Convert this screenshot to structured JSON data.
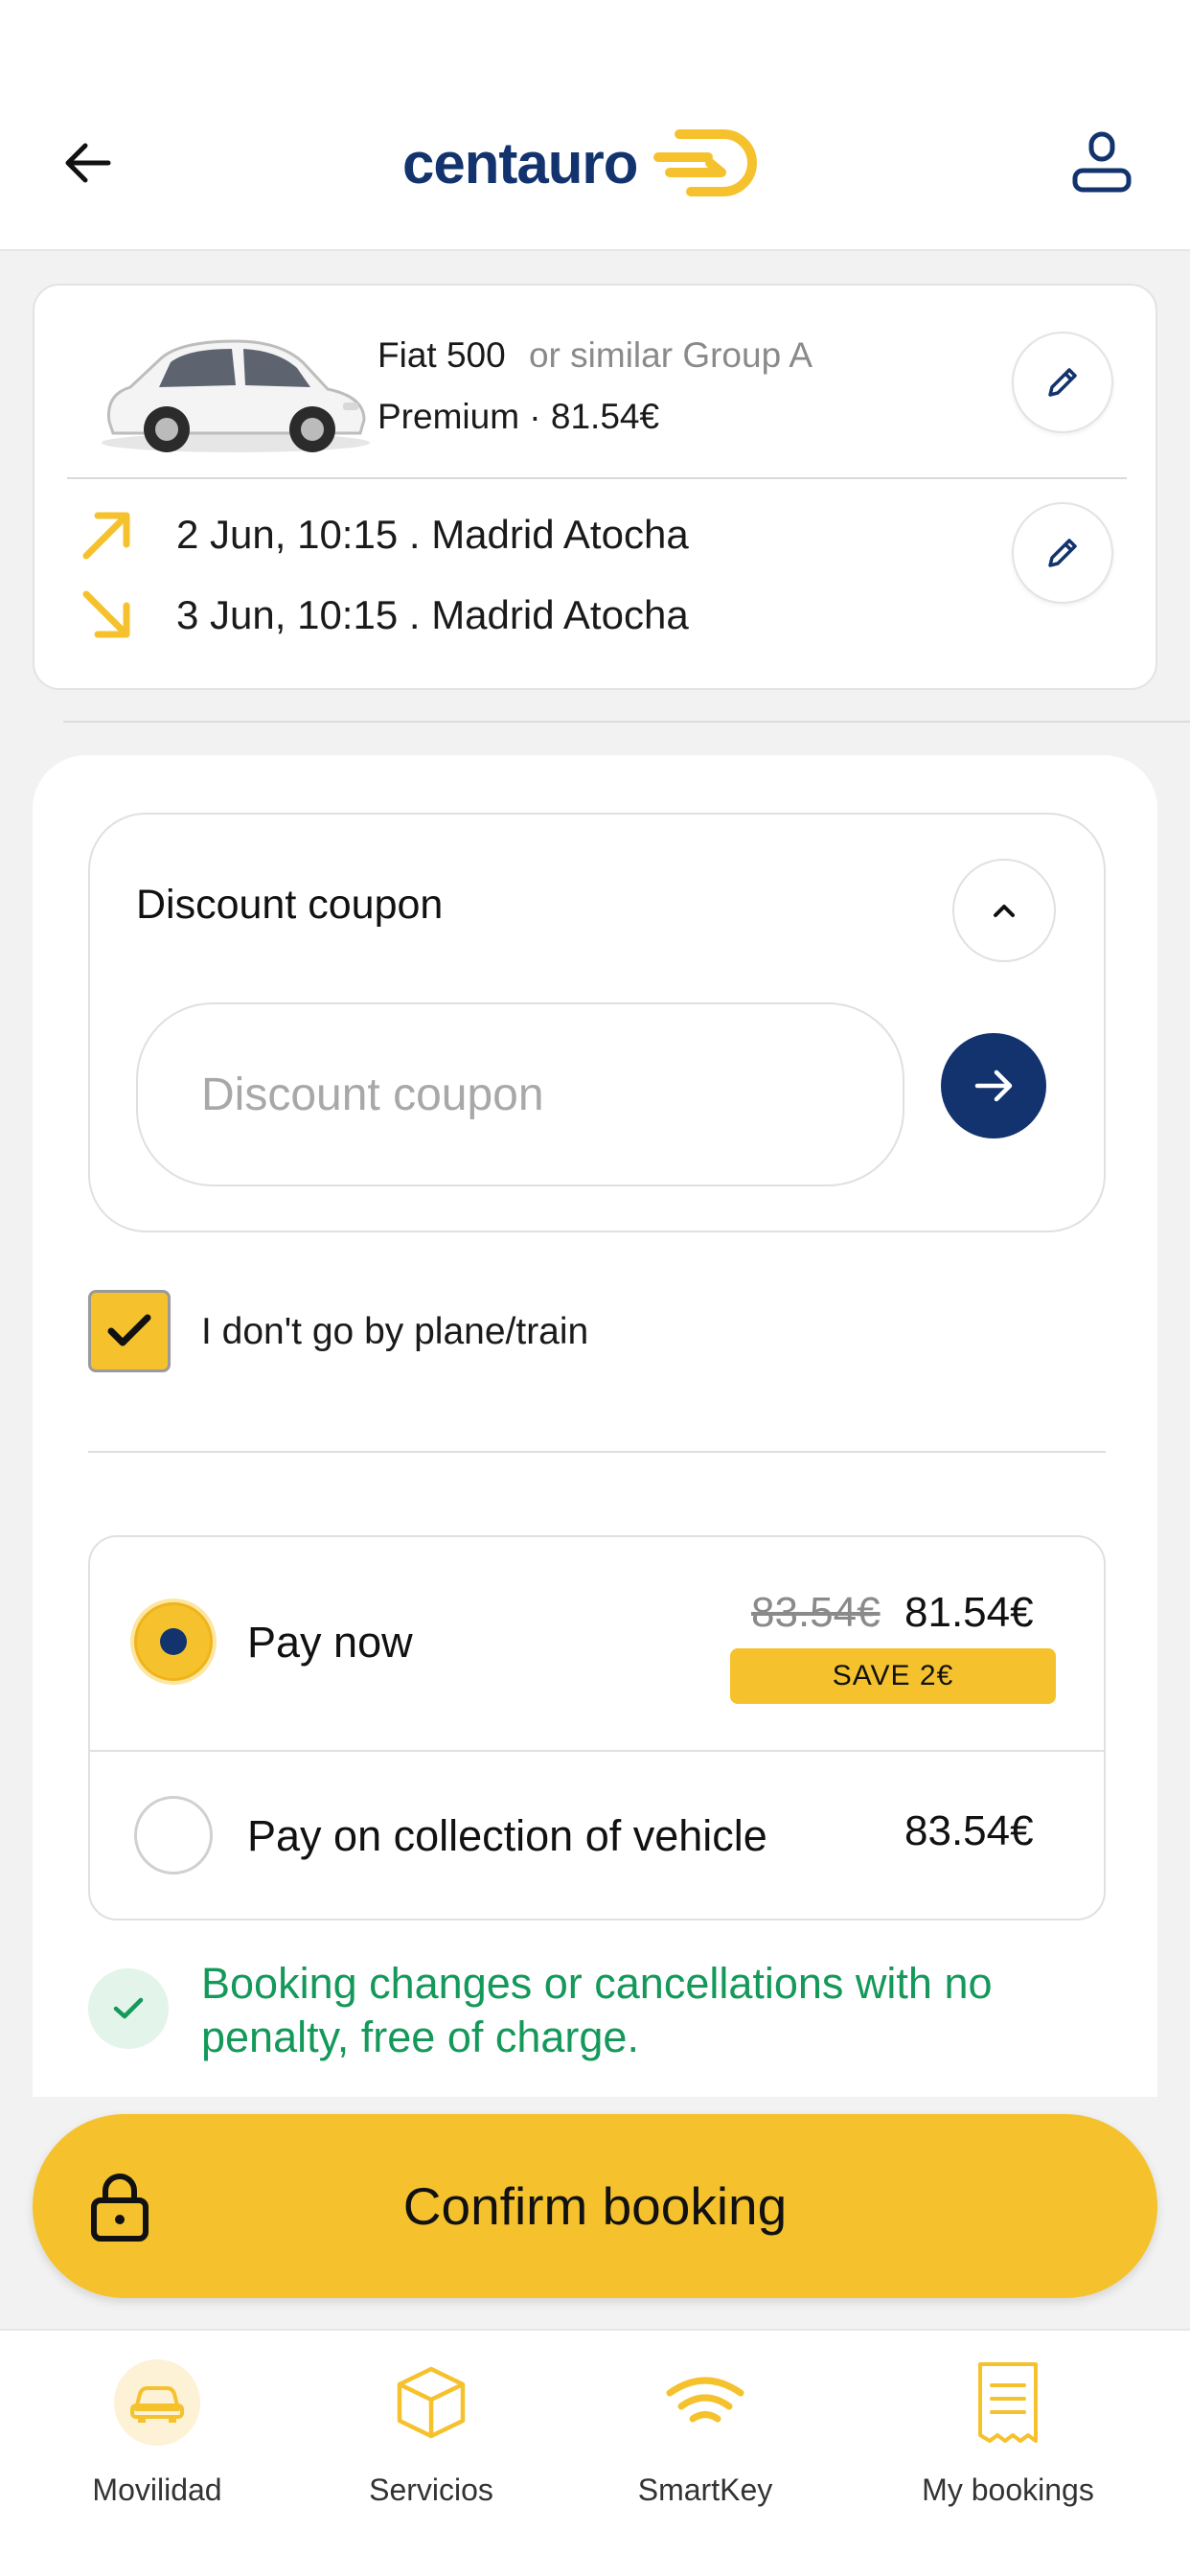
{
  "header": {
    "logo_text": "centauro"
  },
  "summary": {
    "car_name": "Fiat 500",
    "car_similar": "or similar Group A",
    "car_plan": "Premium · 81.54€",
    "pickup": "2 Jun, 10:15 . Madrid Atocha",
    "dropoff": "3 Jun, 10:15 . Madrid Atocha"
  },
  "coupon": {
    "title": "Discount coupon",
    "placeholder": "Discount coupon"
  },
  "no_plane_train": {
    "label": "I don't go by plane/train",
    "checked": true
  },
  "payment": {
    "now": {
      "label": "Pay now",
      "old_price": "83.54€",
      "price": "81.54€",
      "badge": "SAVE 2€",
      "selected": true
    },
    "later": {
      "label": "Pay on collection of vehicle",
      "price": "83.54€",
      "selected": false
    }
  },
  "no_penalty_text": "Booking changes or cancellations with no penalty, free of charge.",
  "confirm_label": "Confirm booking",
  "nav": [
    {
      "label": "Movilidad",
      "icon": "car-icon",
      "active": true
    },
    {
      "label": "Servicios",
      "icon": "box-icon",
      "active": false
    },
    {
      "label": "SmartKey",
      "icon": "wifi-icon",
      "active": false
    },
    {
      "label": "My bookings",
      "icon": "receipt-icon",
      "active": false
    }
  ],
  "colors": {
    "brand_navy": "#12336e",
    "brand_yellow": "#f5c22d",
    "success_green": "#14995a"
  }
}
